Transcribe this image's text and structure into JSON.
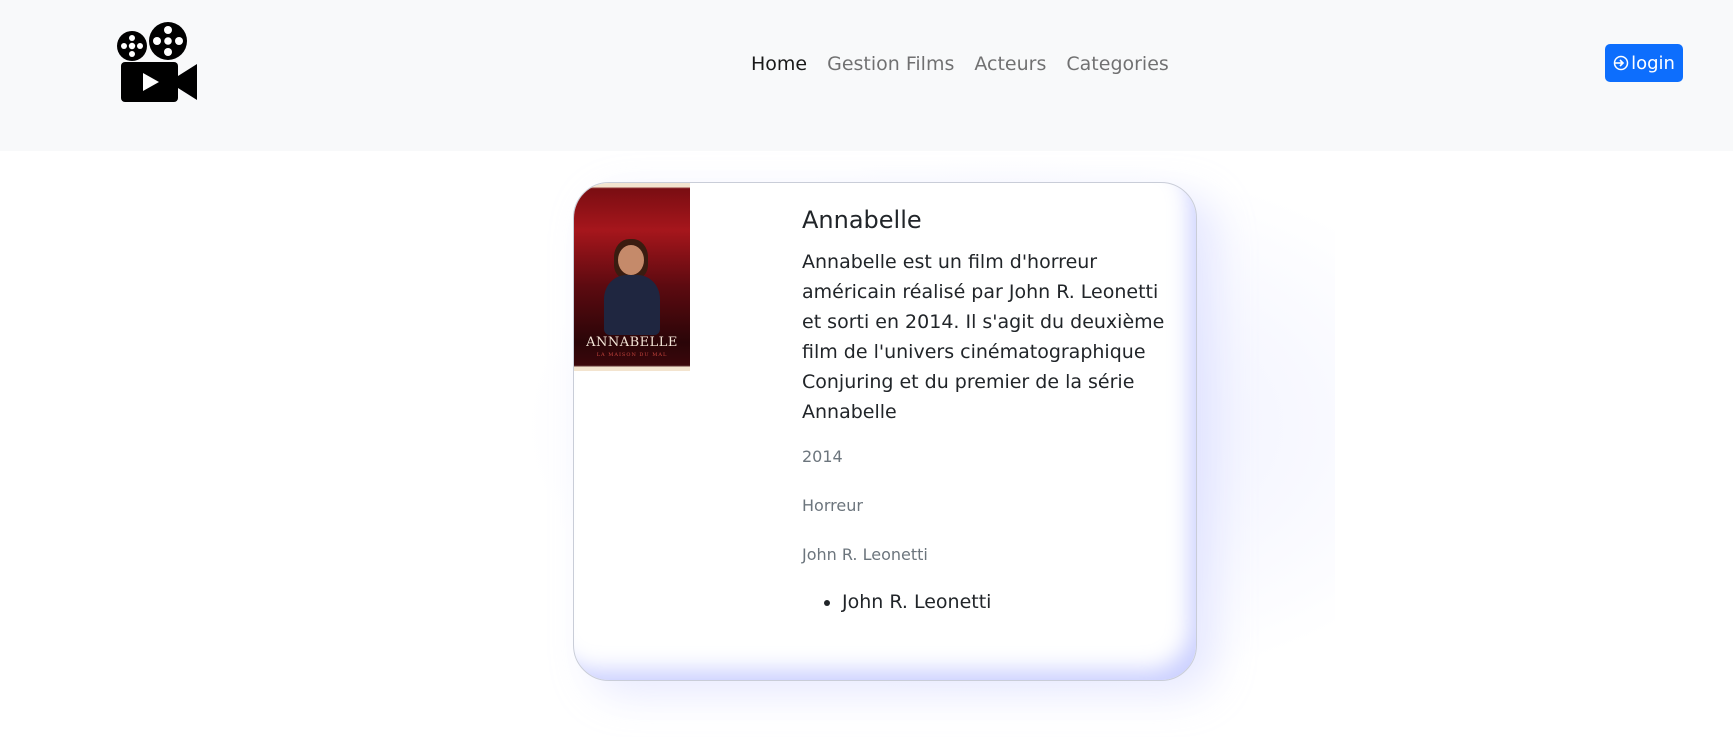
{
  "navbar": {
    "logo_icon": "movie-camera-icon",
    "links": [
      {
        "label": "Home",
        "active": true
      },
      {
        "label": "Gestion Films",
        "active": false
      },
      {
        "label": "Acteurs",
        "active": false
      },
      {
        "label": "Categories",
        "active": false
      }
    ],
    "login_label": "login",
    "login_icon": "sign-in-icon",
    "login_color": "#0d6efd"
  },
  "film": {
    "poster": {
      "title": "ANNABELLE",
      "subtitle": "LA MAISON DU MAL"
    },
    "title": "Annabelle",
    "description": "Annabelle est un film d'horreur américain réalisé par John R. Leonetti et sorti en 2014. Il s'agit du deuxième film de l'univers cinématographique Conjuring et du premier de la série Annabelle",
    "year": "2014",
    "category": "Horreur",
    "director": "John R. Leonetti",
    "actors": [
      "John R. Leonetti"
    ]
  }
}
